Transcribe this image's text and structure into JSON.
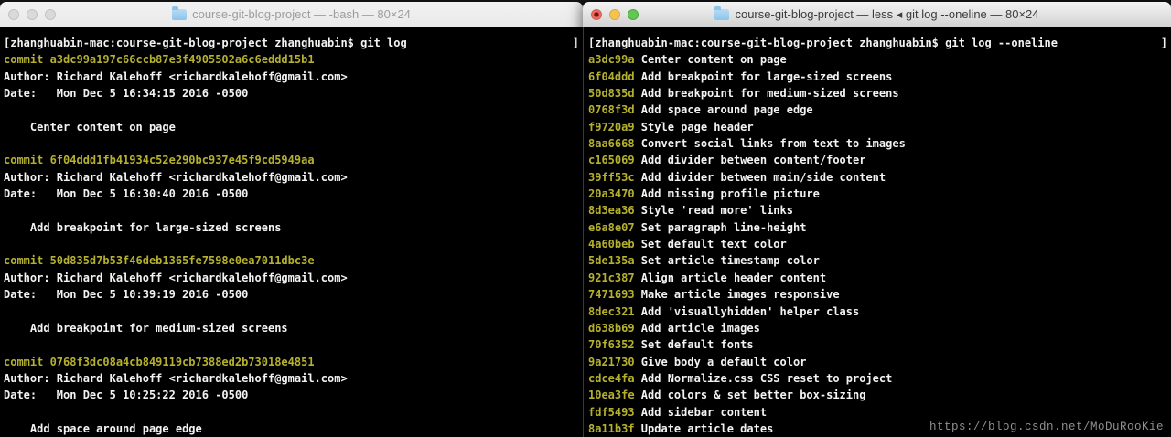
{
  "desktop": {
    "watermark": "https://blog.csdn.net/MoDuRooKie"
  },
  "left_window": {
    "title": "course-git-blog-project — -bash — 80×24",
    "state": "inactive",
    "prompt": "[zhanghuabin-mac:course-git-blog-project zhanghuabin$ git log",
    "prompt_right_bracket": "]",
    "labels": {
      "commit": "commit",
      "author": "Author:",
      "date": "Date:"
    },
    "commits": [
      {
        "hash": "a3dc99a197c66ccb87e3f4905502a6c6eddd15b1",
        "author": "Richard Kalehoff <richardkalehoff@gmail.com>",
        "date": "Mon Dec 5 16:34:15 2016 -0500",
        "message": "Center content on page"
      },
      {
        "hash": "6f04ddd1fb41934c52e290bc937e45f9cd5949aa",
        "author": "Richard Kalehoff <richardkalehoff@gmail.com>",
        "date": "Mon Dec 5 16:30:40 2016 -0500",
        "message": "Add breakpoint for large-sized screens"
      },
      {
        "hash": "50d835d7b53f46deb1365fe7598e0ea7011dbc3e",
        "author": "Richard Kalehoff <richardkalehoff@gmail.com>",
        "date": "Mon Dec 5 10:39:19 2016 -0500",
        "message": "Add breakpoint for medium-sized screens"
      },
      {
        "hash": "0768f3dc08a4cb849119cb7388ed2b73018e4851",
        "author": "Richard Kalehoff <richardkalehoff@gmail.com>",
        "date": "Mon Dec 5 10:25:22 2016 -0500",
        "message": "Add space around page edge"
      }
    ]
  },
  "right_window": {
    "title": "course-git-blog-project — less ◂ git log --oneline — 80×24",
    "state": "active",
    "prompt": "[zhanghuabin-mac:course-git-blog-project zhanghuabin$ git log --oneline",
    "prompt_right_bracket": "]",
    "oneline_commits": [
      {
        "hash": "a3dc99a",
        "message": "Center content on page"
      },
      {
        "hash": "6f04ddd",
        "message": "Add breakpoint for large-sized screens"
      },
      {
        "hash": "50d835d",
        "message": "Add breakpoint for medium-sized screens"
      },
      {
        "hash": "0768f3d",
        "message": "Add space around page edge"
      },
      {
        "hash": "f9720a9",
        "message": "Style page header"
      },
      {
        "hash": "8aa6668",
        "message": "Convert social links from text to images"
      },
      {
        "hash": "c165069",
        "message": "Add divider between content/footer"
      },
      {
        "hash": "39ff53c",
        "message": "Add divider between main/side content"
      },
      {
        "hash": "20a3470",
        "message": "Add missing profile picture"
      },
      {
        "hash": "8d3ea36",
        "message": "Style 'read more' links"
      },
      {
        "hash": "e6a8e07",
        "message": "Set paragraph line-height"
      },
      {
        "hash": "4a60beb",
        "message": "Set default text color"
      },
      {
        "hash": "5de135a",
        "message": "Set article timestamp color"
      },
      {
        "hash": "921c387",
        "message": "Align article header content"
      },
      {
        "hash": "7471693",
        "message": "Make article images responsive"
      },
      {
        "hash": "8dec321",
        "message": "Add 'visuallyhidden' helper class"
      },
      {
        "hash": "d638b69",
        "message": "Add article images"
      },
      {
        "hash": "70f6352",
        "message": "Set default fonts"
      },
      {
        "hash": "9a21730",
        "message": "Give body a default color"
      },
      {
        "hash": "cdce4fa",
        "message": "Add Normalize.css CSS reset to project"
      },
      {
        "hash": "10ea3fe",
        "message": "Add colors & set better box-sizing"
      },
      {
        "hash": "fdf5493",
        "message": "Add sidebar content"
      },
      {
        "hash": "8a11b3f",
        "message": "Update article dates"
      }
    ]
  },
  "colors": {
    "terminal_bg": "#000000",
    "terminal_text": "#f3f3f3",
    "hash_yellow": "#b5b12f",
    "folder_blue": "#8cc4ea"
  }
}
